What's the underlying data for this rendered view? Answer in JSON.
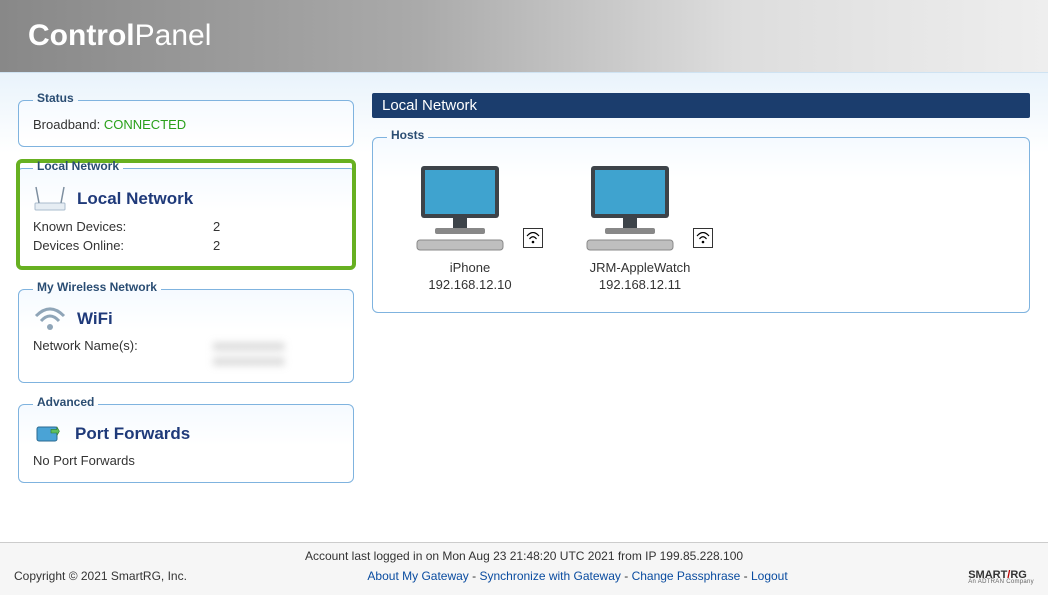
{
  "header": {
    "title_bold": "Control",
    "title_light": "Panel"
  },
  "sidebar": {
    "status": {
      "legend": "Status",
      "broadband_label": "Broadband:",
      "broadband_status": "CONNECTED"
    },
    "local_network": {
      "legend": "Local Network",
      "title": "Local Network",
      "known_devices_label": "Known Devices:",
      "known_devices_value": "2",
      "devices_online_label": "Devices Online:",
      "devices_online_value": "2"
    },
    "wireless": {
      "legend": "My Wireless Network",
      "title": "WiFi",
      "network_names_label": "Network Name(s):"
    },
    "advanced": {
      "legend": "Advanced",
      "title": "Port Forwards",
      "empty_text": "No Port Forwards"
    }
  },
  "main": {
    "title": "Local Network",
    "hosts_legend": "Hosts",
    "hosts": [
      {
        "name": "iPhone",
        "ip": "192.168.12.10"
      },
      {
        "name": "JRM-AppleWatch",
        "ip": "192.168.12.11"
      }
    ]
  },
  "footer": {
    "login_line": "Account last logged in on Mon Aug 23 21:48:20 UTC 2021 from IP 199.85.228.100",
    "copyright": "Copyright © 2021 SmartRG, Inc.",
    "links": {
      "about": "About My Gateway",
      "sync": "Synchronize with Gateway",
      "change_pass": "Change Passphrase",
      "logout": "Logout"
    },
    "brand": "SMARTRG"
  }
}
